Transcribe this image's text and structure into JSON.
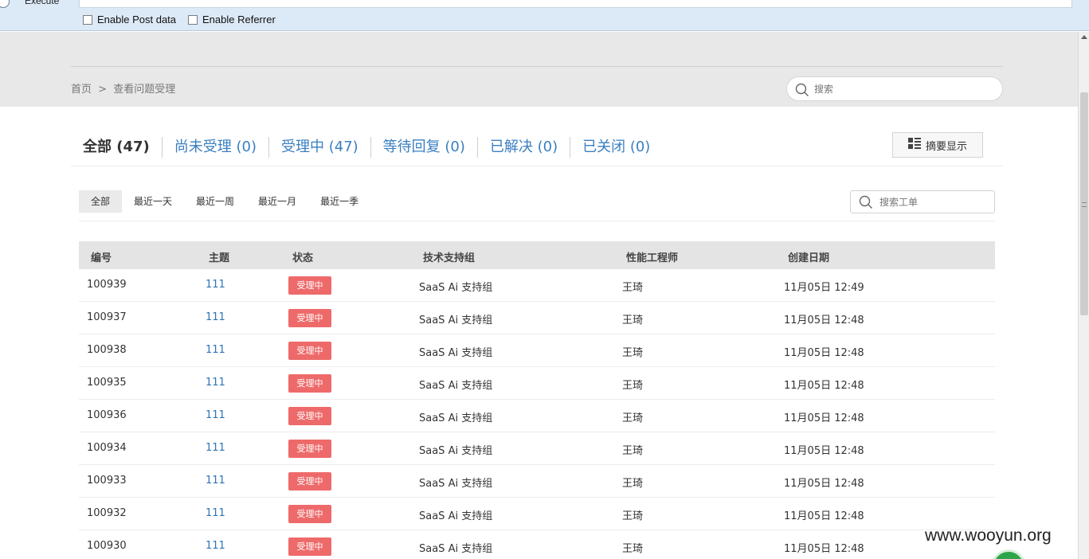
{
  "hackbar": {
    "execute_label": "Execute",
    "enable_post_label": "Enable Post data",
    "enable_referrer_label": "Enable Referrer"
  },
  "breadcrumb": {
    "home": "首页",
    "separator": ">",
    "current": "查看问题受理"
  },
  "top_search": {
    "placeholder": "搜索"
  },
  "status_tabs": [
    {
      "label": "全部 (47)"
    },
    {
      "label": "尚未受理 (0)"
    },
    {
      "label": "受理中 (47)"
    },
    {
      "label": "等待回复 (0)"
    },
    {
      "label": "已解决 (0)"
    },
    {
      "label": "已关闭 (0)"
    }
  ],
  "summary_button": {
    "label": "摘要显示"
  },
  "time_filters": [
    {
      "label": "全部"
    },
    {
      "label": "最近一天"
    },
    {
      "label": "最近一周"
    },
    {
      "label": "最近一月"
    },
    {
      "label": "最近一季"
    }
  ],
  "ticket_search": {
    "placeholder": "搜索工单"
  },
  "table": {
    "headers": {
      "id": "编号",
      "subject": "主题",
      "status": "状态",
      "group": "技术支持组",
      "engineer": "性能工程师",
      "created": "创建日期"
    },
    "rows": [
      {
        "id": "100939",
        "subject": "111",
        "status": "受理中",
        "group": "SaaS Ai 支持组",
        "engineer": "王琦",
        "created": "11月05日 12:49"
      },
      {
        "id": "100937",
        "subject": "111",
        "status": "受理中",
        "group": "SaaS Ai 支持组",
        "engineer": "王琦",
        "created": "11月05日 12:48"
      },
      {
        "id": "100938",
        "subject": "111",
        "status": "受理中",
        "group": "SaaS Ai 支持组",
        "engineer": "王琦",
        "created": "11月05日 12:48"
      },
      {
        "id": "100935",
        "subject": "111",
        "status": "受理中",
        "group": "SaaS Ai 支持组",
        "engineer": "王琦",
        "created": "11月05日 12:48"
      },
      {
        "id": "100936",
        "subject": "111",
        "status": "受理中",
        "group": "SaaS Ai 支持组",
        "engineer": "王琦",
        "created": "11月05日 12:48"
      },
      {
        "id": "100934",
        "subject": "111",
        "status": "受理中",
        "group": "SaaS Ai 支持组",
        "engineer": "王琦",
        "created": "11月05日 12:48"
      },
      {
        "id": "100933",
        "subject": "111",
        "status": "受理中",
        "group": "SaaS Ai 支持组",
        "engineer": "王琦",
        "created": "11月05日 12:48"
      },
      {
        "id": "100932",
        "subject": "111",
        "status": "受理中",
        "group": "SaaS Ai 支持组",
        "engineer": "王琦",
        "created": "11月05日 12:48"
      },
      {
        "id": "100930",
        "subject": "111",
        "status": "受理中",
        "group": "SaaS Ai 支持组",
        "engineer": "王琦",
        "created": "11月05日 12:48"
      }
    ]
  },
  "watermark": {
    "text": "www.wooyun.org"
  },
  "colors": {
    "link": "#2f74b5",
    "status_badge": "#ee6a6a",
    "header_band": "#e8e8e8",
    "hackbar": "#dce9f7"
  }
}
